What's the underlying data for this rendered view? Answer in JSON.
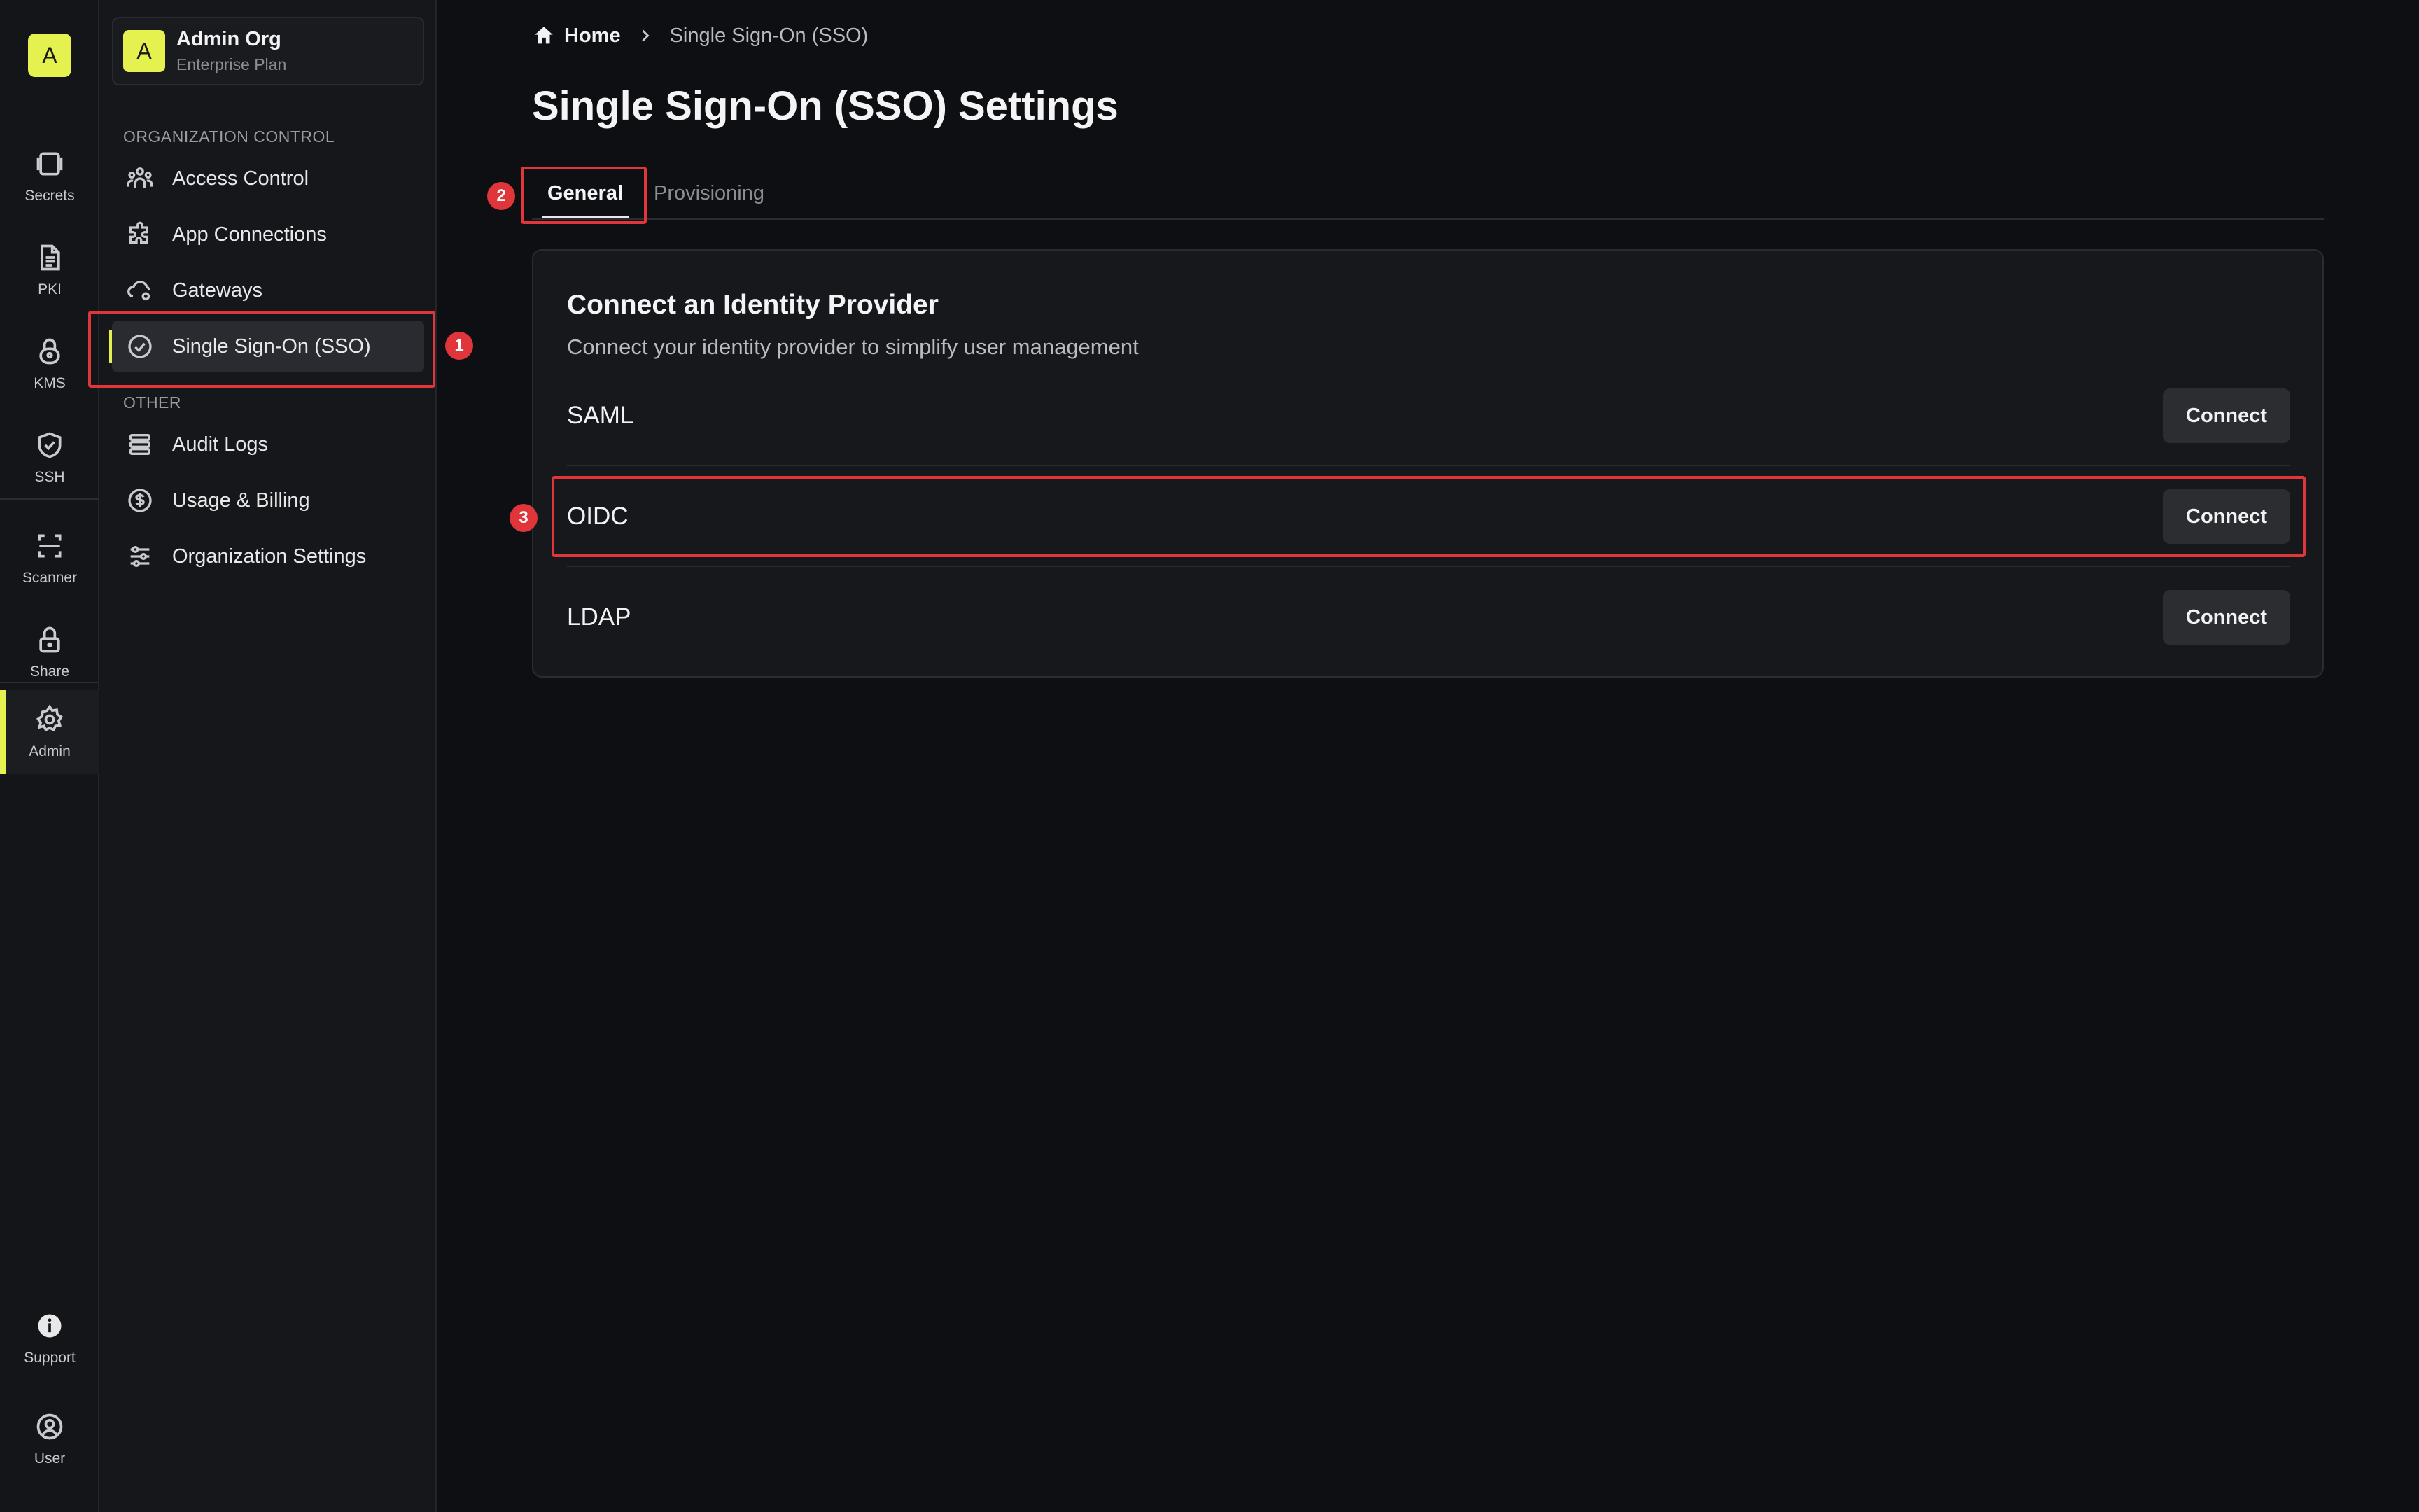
{
  "org": {
    "initial": "A",
    "name": "Admin Org",
    "plan": "Enterprise Plan"
  },
  "rail": {
    "items": [
      {
        "label": "Secrets",
        "icon": "vault-icon"
      },
      {
        "label": "PKI",
        "icon": "document-icon"
      },
      {
        "label": "KMS",
        "icon": "lock-key-icon"
      },
      {
        "label": "SSH",
        "icon": "shield-check-icon"
      },
      {
        "label": "Scanner",
        "icon": "scan-icon"
      },
      {
        "label": "Share",
        "icon": "lock-icon"
      },
      {
        "label": "Admin",
        "icon": "gear-icon"
      },
      {
        "label": "Support",
        "icon": "info-icon"
      },
      {
        "label": "User",
        "icon": "user-circle-icon"
      }
    ],
    "active": "Admin"
  },
  "sidebar": {
    "section_org": "ORGANIZATION CONTROL",
    "section_other": "OTHER",
    "org_items": [
      {
        "label": "Access Control",
        "icon": "users-icon"
      },
      {
        "label": "App Connections",
        "icon": "puzzle-icon"
      },
      {
        "label": "Gateways",
        "icon": "cloud-gear-icon"
      },
      {
        "label": "Single Sign-On (SSO)",
        "icon": "check-circle-icon"
      }
    ],
    "other_items": [
      {
        "label": "Audit Logs",
        "icon": "list-icon"
      },
      {
        "label": "Usage & Billing",
        "icon": "dollar-icon"
      },
      {
        "label": "Organization Settings",
        "icon": "sliders-icon"
      }
    ],
    "active": "Single Sign-On (SSO)"
  },
  "breadcrumb": {
    "home": "Home",
    "current": "Single Sign-On (SSO)"
  },
  "page": {
    "title": "Single Sign-On (SSO) Settings"
  },
  "tabs": [
    {
      "label": "General",
      "active": true
    },
    {
      "label": "Provisioning",
      "active": false
    }
  ],
  "card": {
    "title": "Connect an Identity Provider",
    "subtitle": "Connect your identity provider to simplify user management",
    "providers": [
      {
        "name": "SAML",
        "action": "Connect"
      },
      {
        "name": "OIDC",
        "action": "Connect"
      },
      {
        "name": "LDAP",
        "action": "Connect"
      }
    ]
  },
  "annotations": [
    "1",
    "2",
    "3"
  ],
  "colors": {
    "accent": "#e5f14f",
    "highlight": "#e0353a",
    "background": "#0e0f12"
  }
}
